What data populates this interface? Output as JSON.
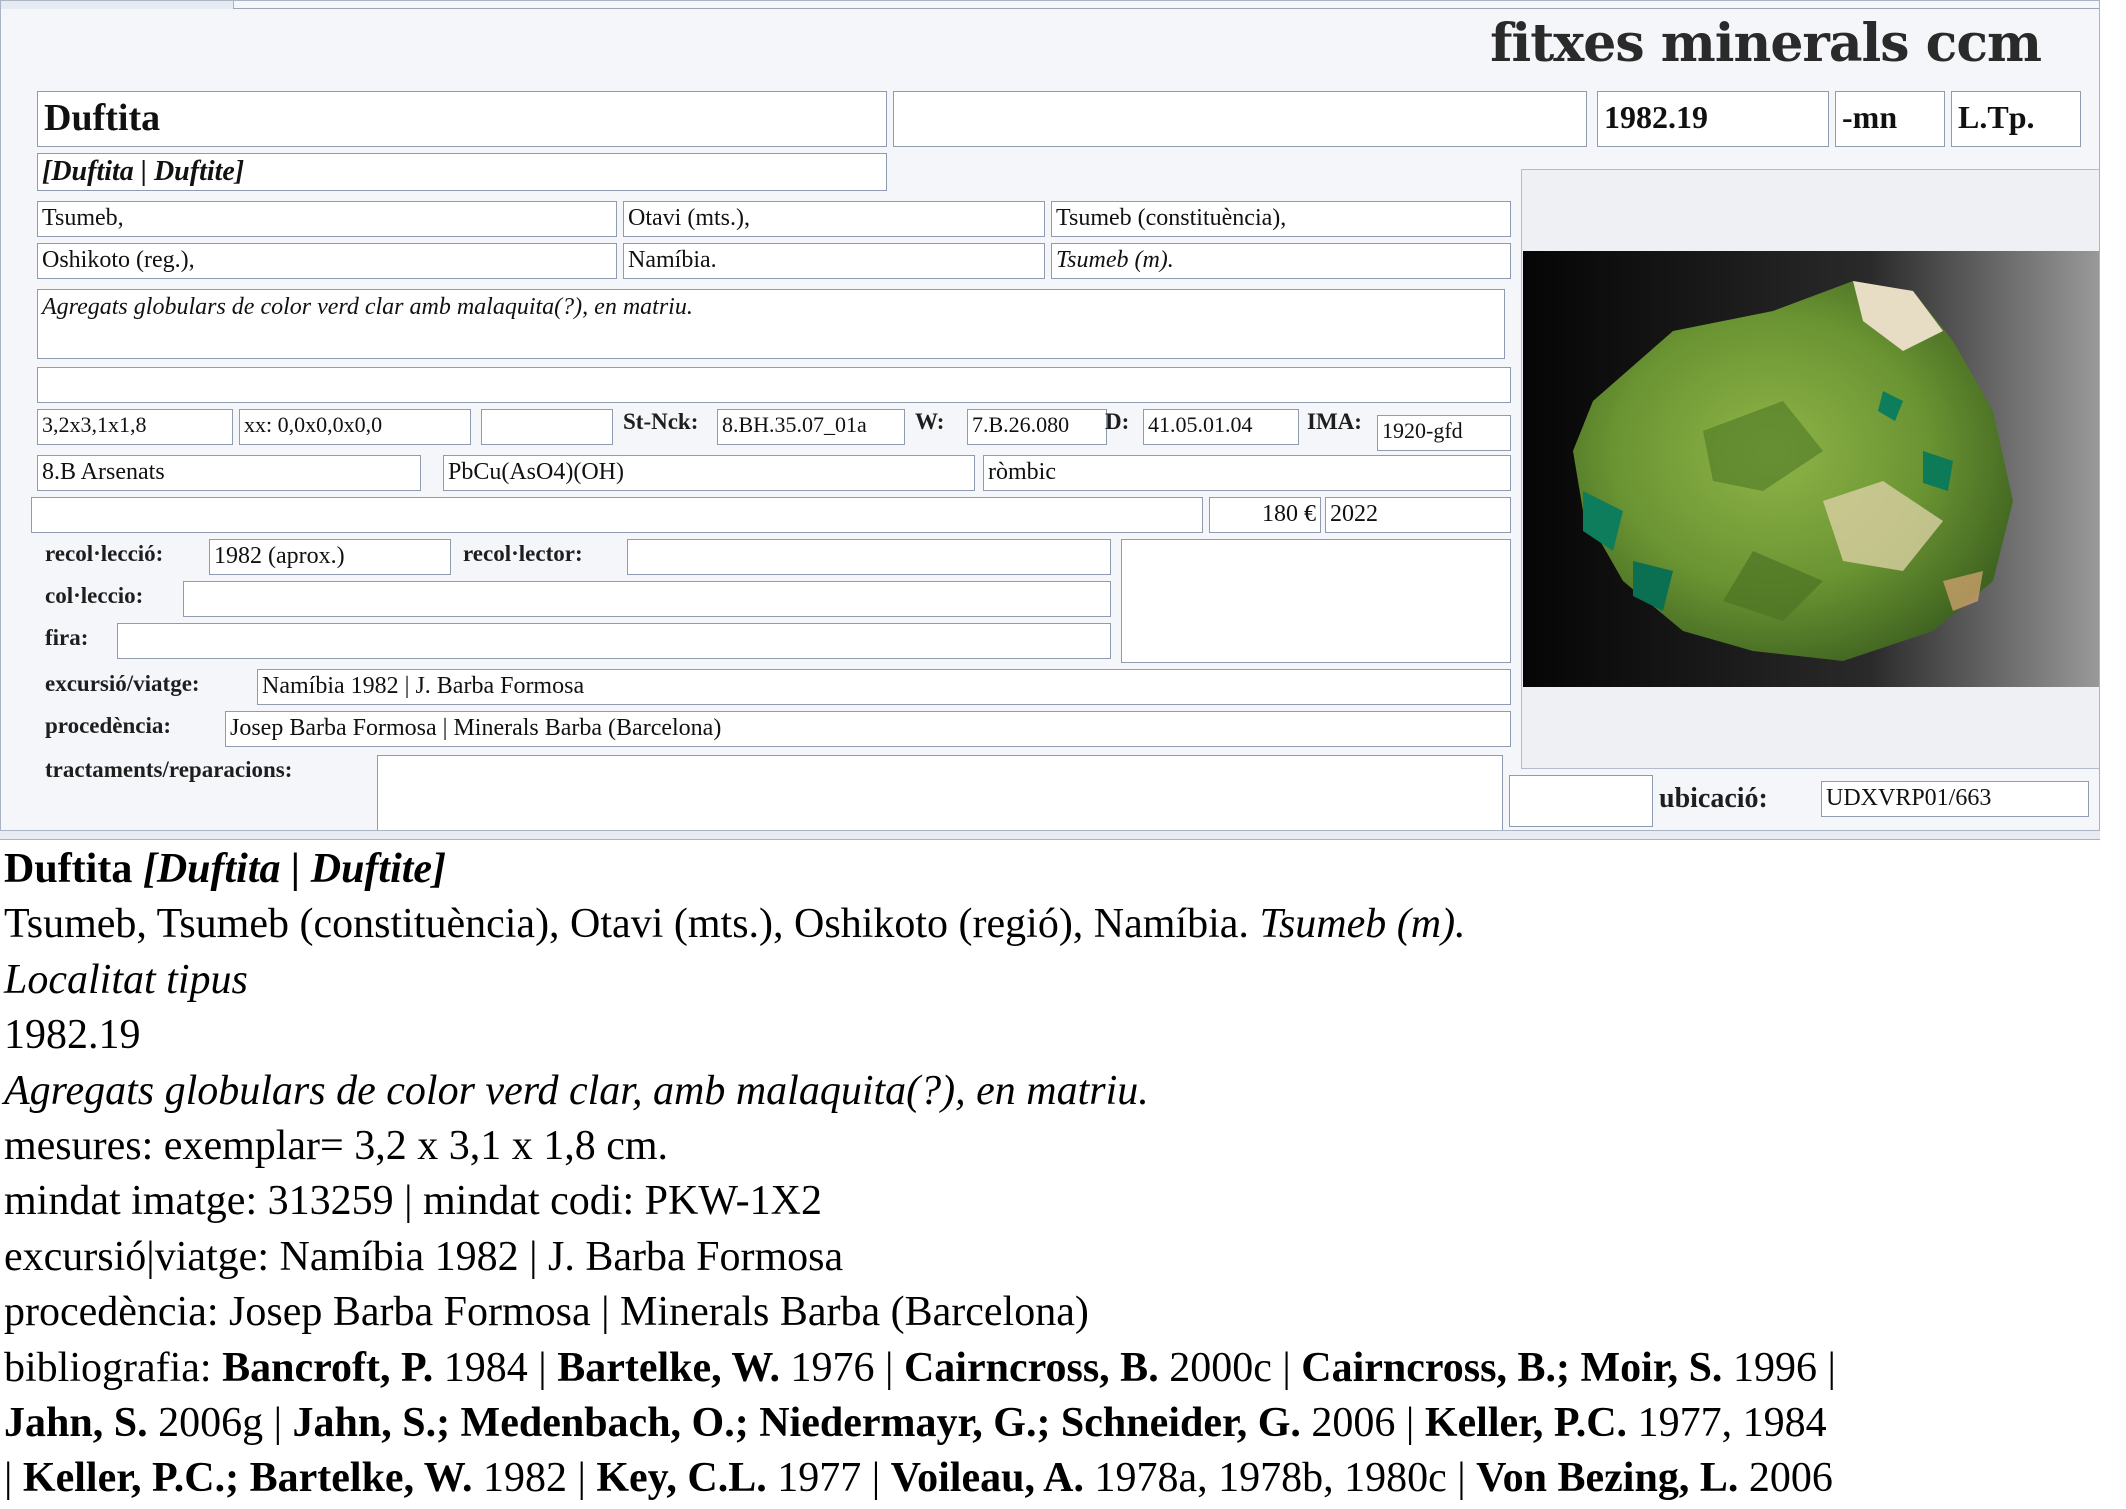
{
  "form": {
    "brand": "fitxes minerals ccm",
    "name": "Duftita",
    "name_extra": "",
    "catalog_no": "1982.19",
    "suffix": "-mn",
    "type_flag": "L.Tp.",
    "synonyms": "[Duftita | Duftite]",
    "loc1": "Tsumeb,",
    "loc2": "Otavi (mts.),",
    "loc3": "Tsumeb (constituència),",
    "loc4": "Oshikoto (reg.),",
    "loc5": "Namíbia.",
    "loc6": "Tsumeb (m).",
    "description": "Agregats globulars de color verd clar amb malaquita(?), en matriu.",
    "notes": "",
    "size": "3,2x3,1x1,8",
    "crystals": "xx: 0,0x0,0x0,0",
    "extra_code": "",
    "strunz_label": "St-Nck:",
    "strunz": "8.BH.35.07_01a",
    "w_label": "W:",
    "w_code": "7.B.26.080",
    "d_label": "D:",
    "d_code": "41.05.01.04",
    "ima_label": "IMA:",
    "ima": "1920-gfd",
    "class": "8.B Arsenats",
    "formula": "PbCu(AsO4)(OH)",
    "system": "ròmbic",
    "misc": "",
    "price": "180 €",
    "year": "2022",
    "recol_leccio_label": "recol·lecció:",
    "recol_leccio": "1982 (aprox.)",
    "recol_lector_label": "recol·lector:",
    "recol_lector": "",
    "col_leccio_label": "col·leccio:",
    "col_leccio": "",
    "fira_label": "fira:",
    "fira": "",
    "notes_box": "",
    "excursio_label": "excursió/viatge:",
    "excursio": "Namíbia 1982 | J. Barba Formosa",
    "procedencia_label": "procedència:",
    "procedencia": "Josep Barba Formosa | Minerals Barba (Barcelona)",
    "tractaments_label": "tractaments/reparacions:",
    "tractaments": "",
    "small_box": "",
    "ubicacio_label": "ubicació:",
    "ubicacio": "UDXVRP01/663"
  },
  "summary": {
    "name": "Duftita",
    "synonyms": "[Duftita | Duftite]",
    "locality": "Tsumeb, Tsumeb (constituència), Otavi (mts.), Oshikoto (regió), Namíbia.",
    "locality_italic": "Tsumeb (m).",
    "type_locality": "Localitat tipus",
    "catalog_no": "1982.19",
    "description": "Agregats globulars de color verd clar, amb malaquita(?), en matriu.",
    "measures": "mesures: exemplar= 3,2 x 3,1 x 1,8 cm.",
    "mindat": "mindat imatge: 313259 | mindat codi: PKW-1X2",
    "excursio": "excursió|viatge: Namíbia 1982 | J. Barba Formosa",
    "procedencia": "procedència: Josep Barba Formosa | Minerals Barba (Barcelona)",
    "bibliografia_label": "bibliografia: ",
    "bib": {
      "a1": "Bancroft, P.",
      "y1": " 1984 | ",
      "a2": "Bartelke, W.",
      "y2": " 1976 | ",
      "a3": "Cairncross, B.",
      "y3": " 2000c | ",
      "a4": "Cairncross, B.; Moir, S.",
      "y4": " 1996 |",
      "a5": "Jahn, S.",
      "y5": " 2006g | ",
      "a6": "Jahn, S.; Medenbach, O.; Niedermayr, G.; Schneider, G.",
      "y6": " 2006 | ",
      "a7": "Keller, P.C.",
      "y7": " 1977, 1984",
      "p8": "| ",
      "a8": "Keller, P.C.; Bartelke, W.",
      "y8": " 1982 | ",
      "a9": "Key, C.L.",
      "y9": " 1977 | ",
      "a10": "Voileau, A.",
      "y10": " 1978a, 1978b, 1980c | ",
      "a11": "Von Bezing, L.",
      "y11": " 2006"
    }
  },
  "colors": {
    "panel": "#f4f6fa",
    "border": "#8e9bb0",
    "mineral_green": "#6f9a35",
    "malachite": "#0f7a5a"
  },
  "icons": {
    "photo": "mineral-photo"
  }
}
